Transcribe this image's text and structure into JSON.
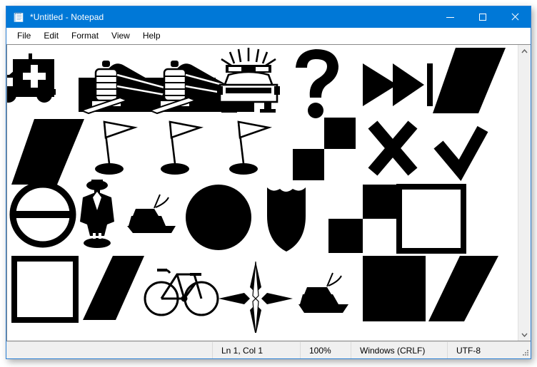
{
  "window": {
    "title": "*Untitled - Notepad",
    "icon": "notepad-icon",
    "accent_color": "#0078d7",
    "border_color": "#2a7fd4",
    "controls": {
      "minimize": "minimize-icon",
      "maximize": "maximize-icon",
      "close": "close-icon"
    }
  },
  "menubar": {
    "items": [
      {
        "label": "File"
      },
      {
        "label": "Edit"
      },
      {
        "label": "Format"
      },
      {
        "label": "View"
      },
      {
        "label": "Help"
      }
    ]
  },
  "statusbar": {
    "cursor_position": "Ln 1, Col 1",
    "zoom": "100%",
    "line_ending": "Windows (CRLF)",
    "encoding": "UTF-8"
  },
  "scrollbar": {
    "up_arrow": "chevron-up-icon",
    "down_arrow": "chevron-down-icon",
    "thumb_visible": false
  },
  "document": {
    "foreground_color": "#000000",
    "background_color": "#ffffff",
    "font_style": "dingbat-symbol-font",
    "rows": [
      {
        "row": 1,
        "glyphs": [
          "ambulance",
          "high-speed-train",
          "high-speed-train",
          "police-car",
          "skip-forward-triangles",
          "parallelogram-slant"
        ]
      },
      {
        "row": 2,
        "glyphs": [
          "parallelogram-slant",
          "golf-flag",
          "golf-flag",
          "golf-flag",
          "checkerboard-two-squares",
          "x-cross-mark",
          "check-mark"
        ]
      },
      {
        "row": 3,
        "glyphs": [
          "no-entry-circle",
          "businessman-figure",
          "motor-yacht",
          "filled-circle",
          "shield",
          "checkerboard-two-squares",
          "outlined-square"
        ]
      },
      {
        "row": 4,
        "glyphs": [
          "outlined-square",
          "parallelogram-slant",
          "bicycle",
          "compass-star",
          "motor-yacht",
          "filled-square",
          "parallelogram-slant"
        ]
      }
    ]
  }
}
